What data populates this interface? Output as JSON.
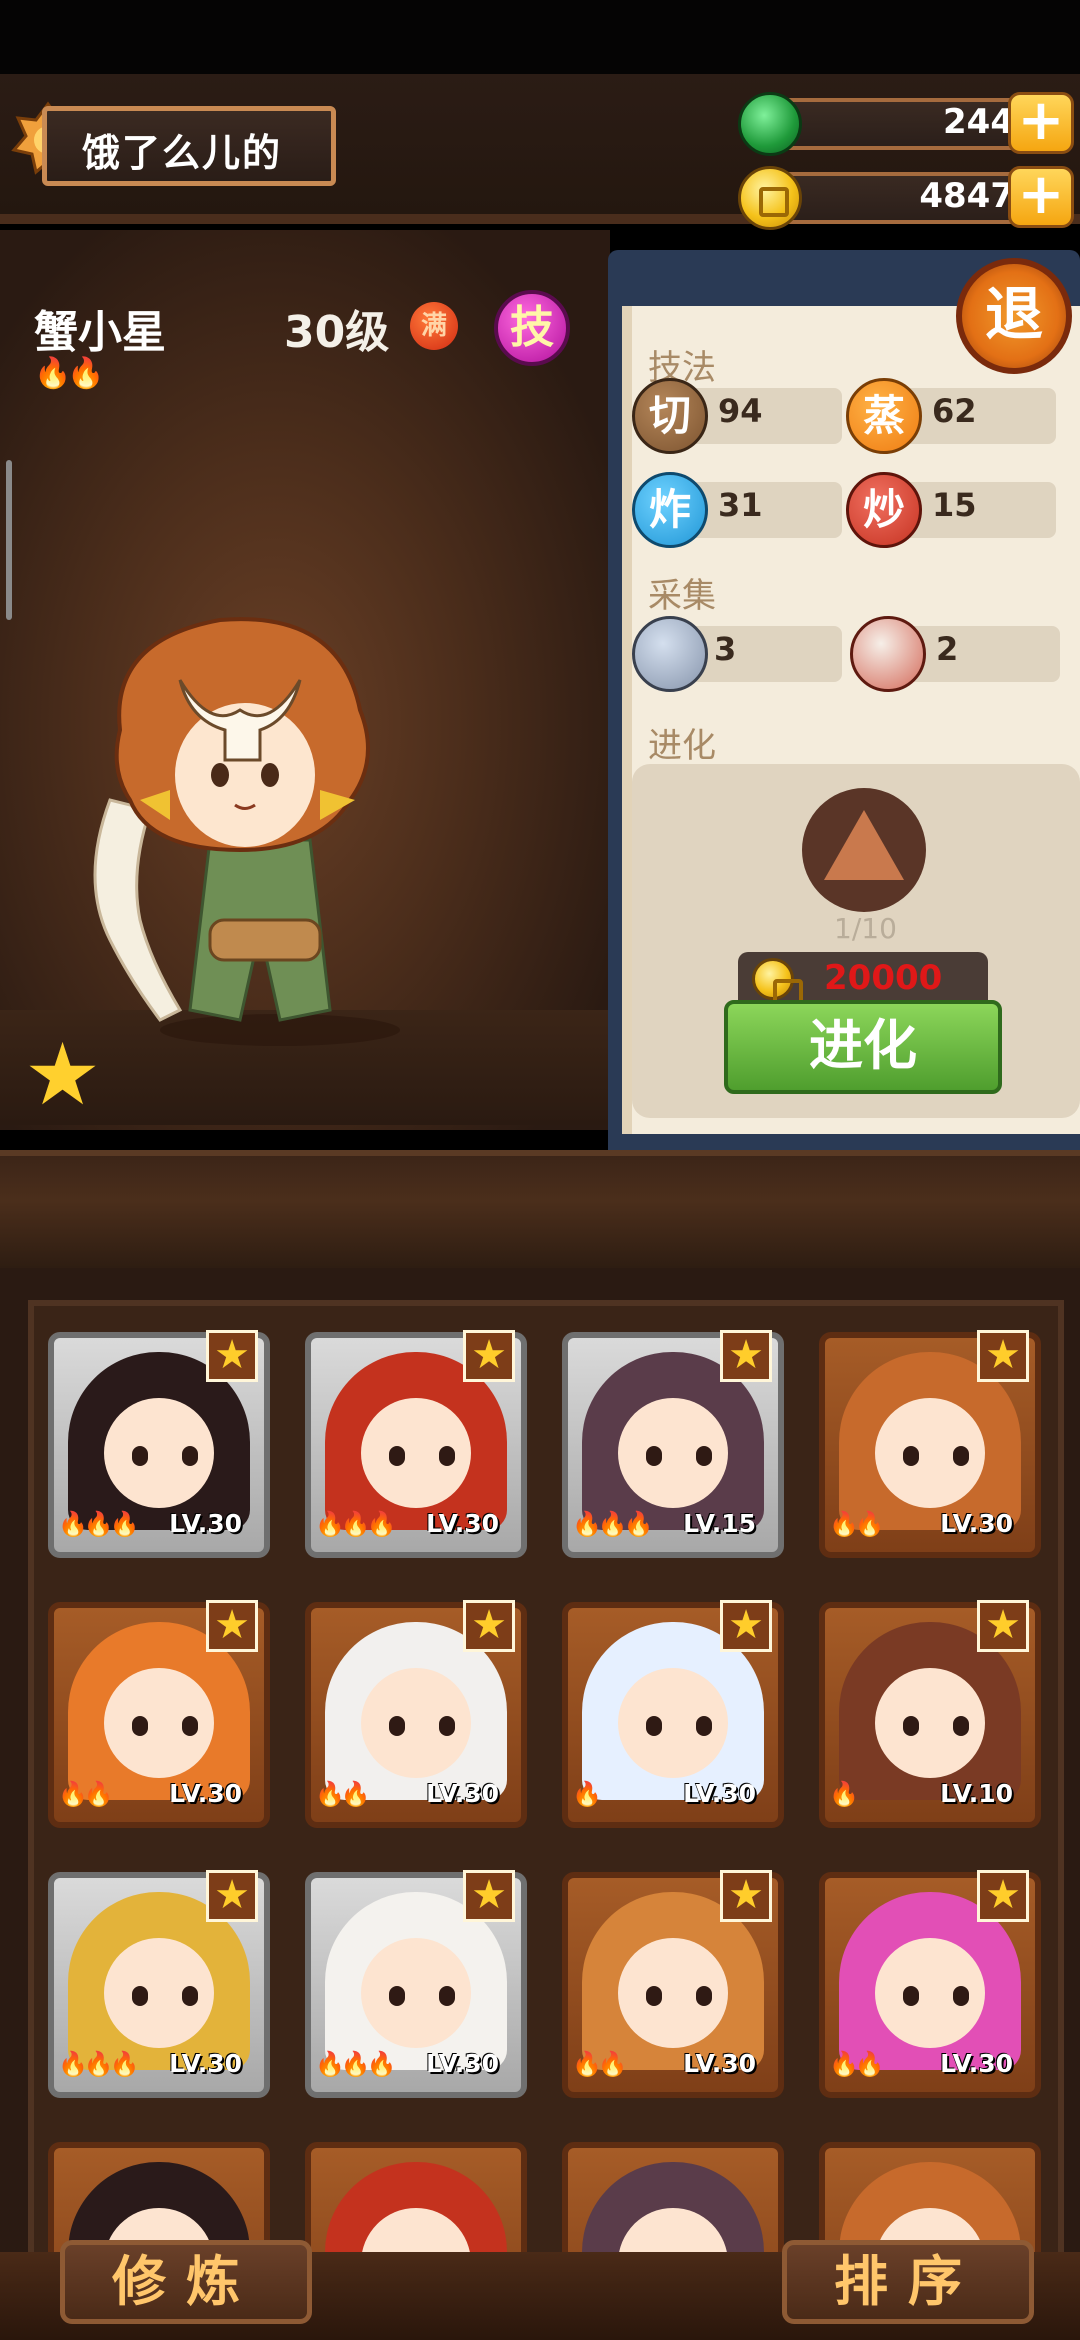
{
  "header": {
    "shop_name": "饿了么儿的",
    "jade": "244",
    "coins": "4847",
    "plus": "+"
  },
  "chef": {
    "name": "蟹小星",
    "level": "30级",
    "max_badge": "满",
    "skill_badge": "技",
    "flames": "🔥🔥",
    "star": "★"
  },
  "panel": {
    "quit_label": "退",
    "skills_title": "技法",
    "skills": [
      {
        "label": "切",
        "value": "94"
      },
      {
        "label": "蒸",
        "value": "62"
      },
      {
        "label": "炸",
        "value": "31"
      },
      {
        "label": "炒",
        "value": "15"
      }
    ],
    "gather_title": "采集",
    "gather": [
      {
        "label": "fish",
        "value": "3"
      },
      {
        "label": "meat",
        "value": "2"
      }
    ],
    "evolve_title": "进化",
    "evolve_count": "1/10",
    "evolve_cost": "20000",
    "evolve_button": "进化"
  },
  "cards": [
    {
      "lv": "LV.30",
      "flames": "🔥🔥🔥"
    },
    {
      "lv": "LV.30",
      "flames": "🔥🔥🔥"
    },
    {
      "lv": "LV.15",
      "flames": "🔥🔥🔥"
    },
    {
      "lv": "LV.30",
      "flames": "🔥🔥"
    },
    {
      "lv": "LV.30",
      "flames": "🔥🔥"
    },
    {
      "lv": "LV.30",
      "flames": "🔥🔥"
    },
    {
      "lv": "LV.30",
      "flames": "🔥"
    },
    {
      "lv": "LV.10",
      "flames": "🔥"
    },
    {
      "lv": "LV.30",
      "flames": "🔥🔥🔥"
    },
    {
      "lv": "LV.30",
      "flames": "🔥🔥🔥"
    },
    {
      "lv": "LV.30",
      "flames": "🔥🔥"
    },
    {
      "lv": "LV.30",
      "flames": "🔥🔥"
    }
  ],
  "bottom": {
    "train": "修炼",
    "sort": "排序"
  },
  "card_star": "★"
}
